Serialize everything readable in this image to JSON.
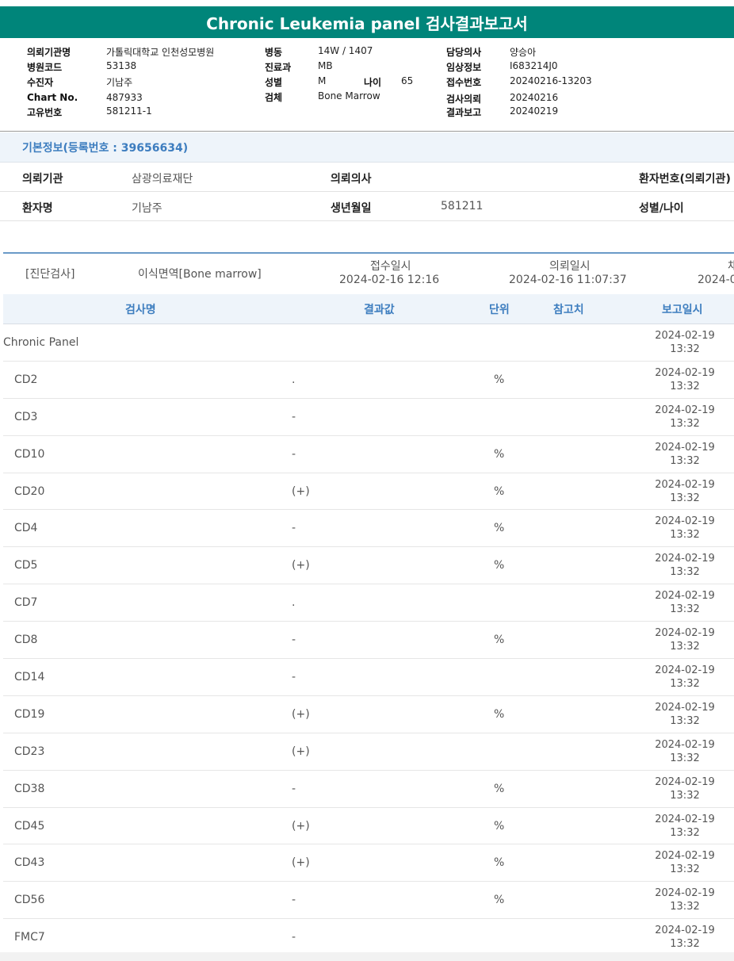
{
  "title": "Chronic Leukemia panel 검사결과보고서",
  "header": {
    "institution_label": "의뢰기관명",
    "institution": "가톨릭대학교 인천성모병원",
    "hospital_code_label": "병원코드",
    "hospital_code": "53138",
    "patient_label": "수진자",
    "patient": "기남주",
    "chart_label": "Chart No.",
    "chart": "487933",
    "unique_label": "고유번호",
    "unique": "581211-1",
    "ward_label": "병동",
    "ward": "14W / 1407",
    "dept_label": "진료과",
    "dept": "MB",
    "sex_label": "성별",
    "sex": "M",
    "age_label": "나이",
    "age": "65",
    "specimen_label": "검체",
    "specimen": "Bone Marrow",
    "doctor_label": "담당의사",
    "doctor": "양승아",
    "clinical_label": "임상정보",
    "clinical": "I683214J0",
    "receipt_label": "접수번호",
    "receipt": "20240216-13203",
    "request_label": "검사의뢰",
    "request": "20240216",
    "report_label": "결과보고",
    "report": "20240219"
  },
  "basic": {
    "title": "기본정보(등록번호 : 39656634)",
    "ref_inst_label": "의뢰기관",
    "ref_inst": "삼광의료재단",
    "ref_doctor_label": "의뢰의사",
    "ref_doctor": "",
    "pt_no_label": "환자번호(의뢰기관)",
    "pt_name_label": "환자명",
    "pt_name": "기남주",
    "birth_label": "생년월일",
    "birth": "581211",
    "sex_age_label": "성별/나이"
  },
  "order": {
    "category": "[진단검사]",
    "test": "이식면역[Bone marrow]",
    "receive_label": "접수일시",
    "receive": "2024-02-16 12:16",
    "request_label": "의뢰일시",
    "request": "2024-02-16 11:07:37",
    "extra_label": "채",
    "extra": "2024-0"
  },
  "columns": {
    "name": "검사명",
    "value": "결과값",
    "unit": "단위",
    "ref": "참고치",
    "date": "보고일시"
  },
  "results": [
    {
      "name": "Chronic Panel",
      "value": "",
      "unit": "",
      "date": "2024-02-19",
      "time": "13:32"
    },
    {
      "name": "CD2",
      "value": ".",
      "unit": "%",
      "date": "2024-02-19",
      "time": "13:32"
    },
    {
      "name": "CD3",
      "value": "-",
      "unit": "",
      "date": "2024-02-19",
      "time": "13:32"
    },
    {
      "name": "CD10",
      "value": "-",
      "unit": "%",
      "date": "2024-02-19",
      "time": "13:32"
    },
    {
      "name": "CD20",
      "value": "(+)",
      "unit": "%",
      "date": "2024-02-19",
      "time": "13:32"
    },
    {
      "name": "CD4",
      "value": "-",
      "unit": "%",
      "date": "2024-02-19",
      "time": "13:32"
    },
    {
      "name": "CD5",
      "value": "(+)",
      "unit": "%",
      "date": "2024-02-19",
      "time": "13:32"
    },
    {
      "name": "CD7",
      "value": ".",
      "unit": "",
      "date": "2024-02-19",
      "time": "13:32"
    },
    {
      "name": "CD8",
      "value": "-",
      "unit": "%",
      "date": "2024-02-19",
      "time": "13:32"
    },
    {
      "name": "CD14",
      "value": "-",
      "unit": "",
      "date": "2024-02-19",
      "time": "13:32"
    },
    {
      "name": "CD19",
      "value": "(+)",
      "unit": "%",
      "date": "2024-02-19",
      "time": "13:32"
    },
    {
      "name": "CD23",
      "value": "(+)",
      "unit": "",
      "date": "2024-02-19",
      "time": "13:32"
    },
    {
      "name": "CD38",
      "value": "-",
      "unit": "%",
      "date": "2024-02-19",
      "time": "13:32"
    },
    {
      "name": "CD45",
      "value": "(+)",
      "unit": "%",
      "date": "2024-02-19",
      "time": "13:32"
    },
    {
      "name": "CD43",
      "value": "(+)",
      "unit": "%",
      "date": "2024-02-19",
      "time": "13:32"
    },
    {
      "name": "CD56",
      "value": "-",
      "unit": "%",
      "date": "2024-02-19",
      "time": "13:32"
    },
    {
      "name": "FMC7",
      "value": "-",
      "unit": "",
      "date": "2024-02-19",
      "time": "13:32"
    }
  ]
}
